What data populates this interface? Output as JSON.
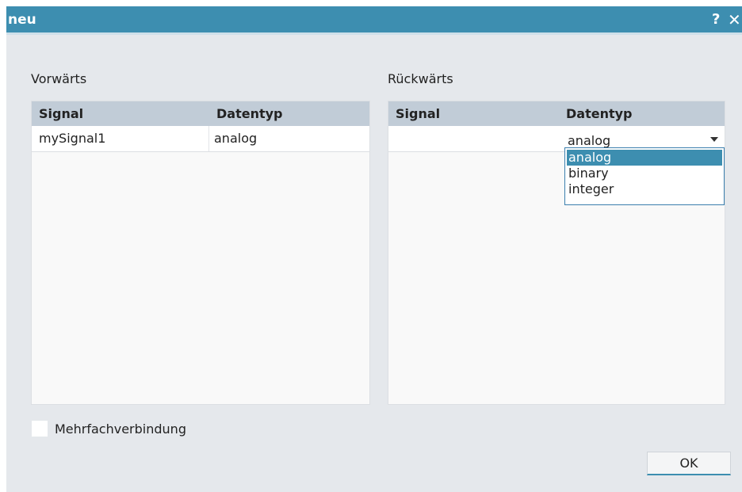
{
  "window": {
    "title": "neu",
    "help_symbol": "?",
    "close_symbol": "✕"
  },
  "forward": {
    "label": "Vorwärts",
    "columns": [
      "Signal",
      "Datentyp"
    ],
    "rows": [
      {
        "signal": "mySignal1",
        "datatype": "analog"
      }
    ]
  },
  "backward": {
    "label": "Rückwärts",
    "columns": [
      "Signal",
      "Datentyp"
    ],
    "rows": [
      {
        "signal": "",
        "datatype": "analog"
      }
    ],
    "dropdown": {
      "open": true,
      "options": [
        "analog",
        "binary",
        "integer"
      ],
      "selected": "analog"
    }
  },
  "multi_connection": {
    "label": "Mehrfachverbindung",
    "checked": false
  },
  "buttons": {
    "ok": "OK"
  },
  "colors": {
    "accent": "#3d8eb0",
    "header_bg": "#c1ccd7",
    "dialog_bg": "#e5e8ec"
  }
}
